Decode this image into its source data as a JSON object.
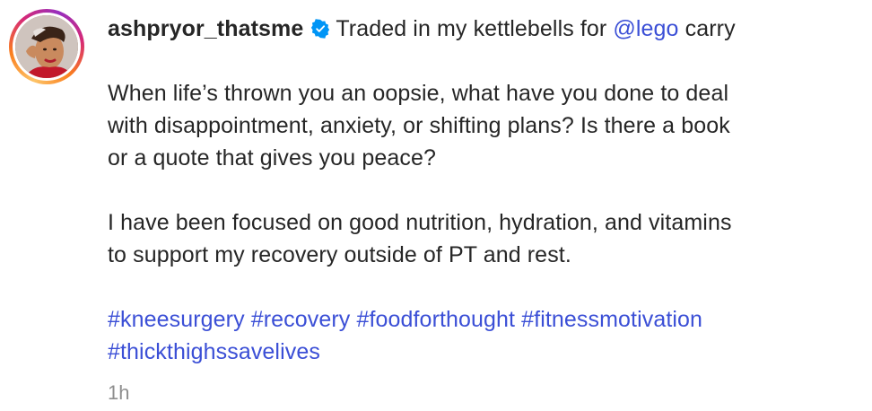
{
  "post": {
    "username": "ashpryor_thatsme",
    "verified": true,
    "caption_title_prefix": "Traded in my kettlebells for",
    "mention": "@lego",
    "caption_title_suffix": "carry",
    "paragraph1": {
      "line1": "When life’s thrown you an oopsie, what have you done to deal",
      "line2": "with disappointment, anxiety, or shifting plans? Is there a book",
      "line3": "or a quote that gives you peace?"
    },
    "paragraph2": {
      "line1": "I have been focused on good nutrition, hydration, and vitamins",
      "line2": "to support my recovery outside of PT and rest."
    },
    "hashtags_line1": [
      "#kneesurgery",
      "#recovery",
      "#foodforthought",
      "#fitnessmotivation"
    ],
    "hashtags_line2": [
      "#thickthighssavelives"
    ],
    "timestamp": "1h"
  },
  "icons": {
    "verified": "verified-badge-icon"
  },
  "colors": {
    "text": "#262626",
    "link": "#3b4fd6",
    "timestamp": "#8e8e8e",
    "verified_badge": "#0095f6"
  }
}
